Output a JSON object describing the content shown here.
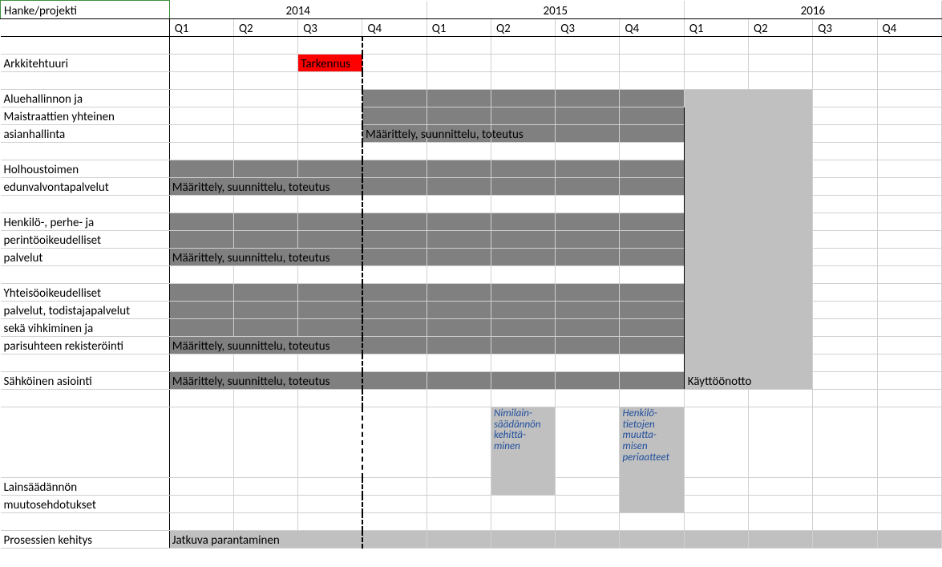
{
  "header": {
    "hanke_label": "Hanke/projekti",
    "years": [
      "2014",
      "2015",
      "2016"
    ],
    "quarters": [
      "Q1",
      "Q2",
      "Q3",
      "Q4",
      "Q1",
      "Q2",
      "Q3",
      "Q4",
      "Q1",
      "Q2",
      "Q3",
      "Q4"
    ]
  },
  "rows": {
    "arkkitehtuuri": {
      "label": "Arkkitehtuuri",
      "bar_label": "Tarkennus"
    },
    "aluehallinto": {
      "label_l1": "Aluehallinnon ja",
      "label_l2": "Maistraattien yhteinen",
      "label_l3": "asianhallinta",
      "bar_label": "Määrittely, suunnittelu, toteutus"
    },
    "holhous": {
      "label_l1": "Holhoustoimen",
      "label_l2": "edunvalvontapalvelut",
      "bar_label": "Määrittely, suunnittelu, toteutus"
    },
    "henkilo": {
      "label_l1": "Henkilö-, perhe- ja",
      "label_l2": "perintöoikeudelliset",
      "label_l3": "palvelut",
      "bar_label": "Määrittely, suunnittelu, toteutus"
    },
    "yhteiso": {
      "label_l1": "Yhteisöoikeudelliset",
      "label_l2": "palvelut, todistajapalvelut",
      "label_l3": "sekä vihkiminen ja",
      "label_l4": "parisuhteen rekisteröinti",
      "bar_label": "Määrittely, suunnittelu, toteutus"
    },
    "sahkoinen": {
      "label": "Sähköinen asiointi",
      "bar_label": "Määrittely, suunnittelu, toteutus"
    },
    "lainsaadanto": {
      "label_l1": "Lainsäädännön",
      "label_l2": "muutosehdotukset",
      "box1": "Nimilain-\nsäädännön\nkehittä-\nminen",
      "box2": "Henkilö-\ntietojen\nmuutta-\nmisen\nperiaatteet"
    },
    "prosessien": {
      "label": "Prosessien kehitys",
      "bar_label": "Jatkuva parantaminen"
    }
  },
  "kayttootto_label": "Käyttöönotto",
  "chart_data": {
    "type": "table",
    "title": "Hanke/projekti roadmap 2014–2016",
    "x_categories": [
      "2014 Q1",
      "2014 Q2",
      "2014 Q3",
      "2014 Q4",
      "2015 Q1",
      "2015 Q2",
      "2015 Q3",
      "2015 Q4",
      "2016 Q1",
      "2016 Q2",
      "2016 Q3",
      "2016 Q4"
    ],
    "today_marker_after": "2014 Q3",
    "rows": [
      {
        "name": "Arkkitehtuuri",
        "bars": [
          {
            "label": "Tarkennus",
            "start": "2014 Q3",
            "end": "2014 Q3",
            "color": "red"
          }
        ]
      },
      {
        "name": "Aluehallinnon ja Maistraattien yhteinen asianhallinta",
        "bars": [
          {
            "label": "Määrittely, suunnittelu, toteutus",
            "start": "2014 Q4",
            "end": "2015 Q4",
            "color": "darkgray"
          },
          {
            "label": "Käyttöönotto",
            "start": "2016 Q1",
            "end": "2016 Q2",
            "color": "lightgray"
          }
        ]
      },
      {
        "name": "Holhoustoimen edunvalvontapalvelut",
        "bars": [
          {
            "label": "Määrittely, suunnittelu, toteutus",
            "start": "2014 Q1",
            "end": "2015 Q4",
            "color": "darkgray"
          },
          {
            "label": "Käyttöönotto",
            "start": "2016 Q1",
            "end": "2016 Q2",
            "color": "lightgray"
          }
        ]
      },
      {
        "name": "Henkilö-, perhe- ja perintöoikeudelliset palvelut",
        "bars": [
          {
            "label": "Määrittely, suunnittelu, toteutus",
            "start": "2014 Q1",
            "end": "2015 Q4",
            "color": "darkgray"
          },
          {
            "label": "Käyttöönotto",
            "start": "2016 Q1",
            "end": "2016 Q2",
            "color": "lightgray"
          }
        ]
      },
      {
        "name": "Yhteisöoikeudelliset palvelut, todistajapalvelut sekä vihkiminen ja parisuhteen rekisteröinti",
        "bars": [
          {
            "label": "Määrittely, suunnittelu, toteutus",
            "start": "2014 Q1",
            "end": "2015 Q4",
            "color": "darkgray"
          },
          {
            "label": "Käyttöönotto",
            "start": "2016 Q1",
            "end": "2016 Q2",
            "color": "lightgray"
          }
        ]
      },
      {
        "name": "Sähköinen asiointi",
        "bars": [
          {
            "label": "Määrittely, suunnittelu, toteutus",
            "start": "2014 Q1",
            "end": "2015 Q4",
            "color": "darkgray"
          },
          {
            "label": "Käyttöönotto",
            "start": "2016 Q1",
            "end": "2016 Q2",
            "color": "lightgray"
          }
        ]
      },
      {
        "name": "Lainsäädännön muutosehdotukset",
        "bars": [
          {
            "label": "Nimilainsäädännön kehittäminen",
            "start": "2015 Q2",
            "end": "2015 Q2",
            "color": "lightgray"
          },
          {
            "label": "Henkilötietojen muuttamisen periaatteet",
            "start": "2015 Q4",
            "end": "2015 Q4",
            "color": "lightgray"
          }
        ]
      },
      {
        "name": "Prosessien kehitys",
        "bars": [
          {
            "label": "Jatkuva parantaminen",
            "start": "2014 Q1",
            "end": "2016 Q4",
            "color": "lightgray"
          }
        ]
      }
    ]
  }
}
